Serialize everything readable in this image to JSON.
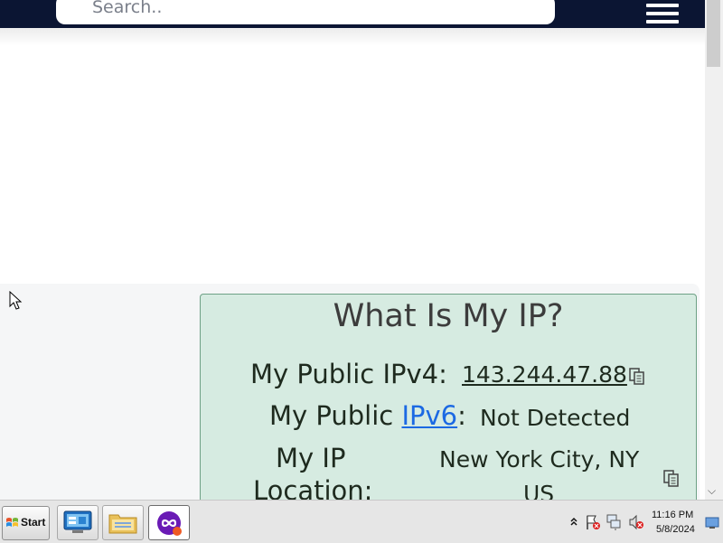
{
  "nav": {
    "search_placeholder": "Search..",
    "menu_icon": "hamburger-icon"
  },
  "card": {
    "title": "What Is My IP?",
    "ipv4_label": "My Public IPv4:",
    "ipv4_value": "143.244.47.88",
    "ipv6_label_prefix": "My Public",
    "ipv6_link": "IPv6",
    "ipv6_colon": ":",
    "ipv6_value": "Not Detected",
    "location_label_line1": "My IP",
    "location_label_line2": "Location:",
    "location_value_line1": "New York City, NY",
    "location_value_line2": "US"
  },
  "colors": {
    "nav_bg": "#0b1533",
    "card_bg": "#d6ebe1",
    "link": "#1b69e3"
  },
  "taskbar": {
    "start_label": "Start",
    "apps": [
      "server-manager-icon",
      "file-explorer-icon",
      "infinity-app-icon"
    ],
    "tray_icons": [
      "show-hidden-icons-chevron",
      "action-center-flag-icon",
      "network-icon",
      "volume-muted-icon",
      "show-desktop-icon"
    ],
    "time": "11:16 PM",
    "date": "5/8/2024"
  }
}
